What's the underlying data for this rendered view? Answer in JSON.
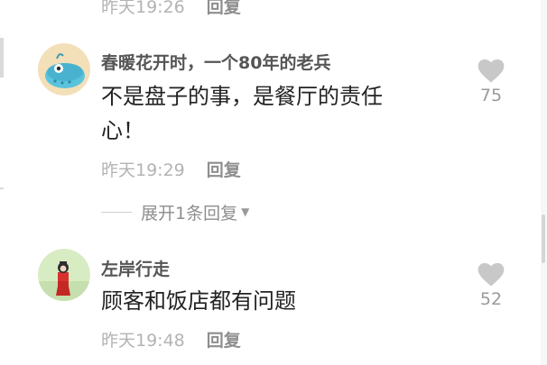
{
  "comments": [
    {
      "time": "昨天19:26",
      "reply_label": "回复"
    },
    {
      "username": "春暖花开时，一个80年的老兵",
      "content_line1": "不是盘子的事，是餐厅的责任",
      "content_line2": "心！",
      "likes": "75",
      "time": "昨天19:29",
      "reply_label": "回复",
      "expand_label": "展开1条回复"
    },
    {
      "username": "左岸行走",
      "content_line1": "顾客和饭店都有问题",
      "likes": "52",
      "time": "昨天19:48",
      "reply_label": "回复"
    }
  ],
  "colors": {
    "text": "#222222",
    "username": "#555555",
    "meta": "#b3b3b3",
    "reply": "#8e8e8e",
    "heart": "#c8c8c8"
  },
  "icons": {
    "like": "heart-icon",
    "expand": "caret-down-icon"
  }
}
